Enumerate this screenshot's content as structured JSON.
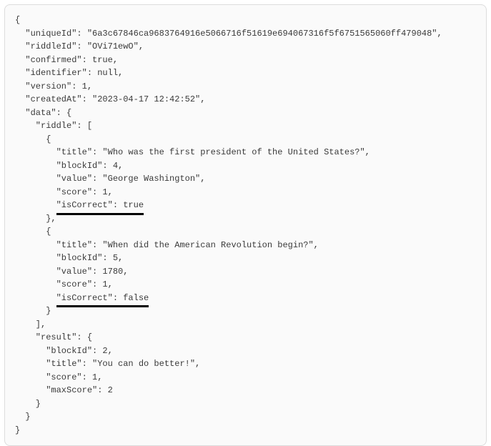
{
  "lines": {
    "l0": "{",
    "l1": "  \"uniqueId\": \"6a3c67846ca9683764916e5066716f51619e694067316f5f6751565060ff479048\",",
    "l2": "  \"riddleId\": \"OVi71ewO\",",
    "l3": "  \"confirmed\": true,",
    "l4": "  \"identifier\": null,",
    "l5": "  \"version\": 1,",
    "l6": "  \"createdAt\": \"2023-04-17 12:42:52\",",
    "l7": "  \"data\": {",
    "l8": "    \"riddle\": [",
    "l9": "      {",
    "l10": "        \"title\": \"Who was the first president of the United States?\",",
    "l11": "        \"blockId\": 4,",
    "l12": "        \"value\": \"George Washington\",",
    "l13": "        \"score\": 1,",
    "l14a": "        ",
    "l14b": "\"isCorrect\": true",
    "l15": "      },",
    "l16": "      {",
    "l17": "        \"title\": \"When did the American Revolution begin?\",",
    "l18": "        \"blockId\": 5,",
    "l19": "        \"value\": 1780,",
    "l20": "        \"score\": 1,",
    "l21a": "        ",
    "l21b": "\"isCorrect\": false",
    "l22": "      }",
    "l23": "    ],",
    "l24": "    \"result\": {",
    "l25": "      \"blockId\": 2,",
    "l26": "      \"title\": \"You can do better!\",",
    "l27": "      \"score\": 1,",
    "l28": "      \"maxScore\": 2",
    "l29": "    }",
    "l30": "  }",
    "l31": "}"
  }
}
